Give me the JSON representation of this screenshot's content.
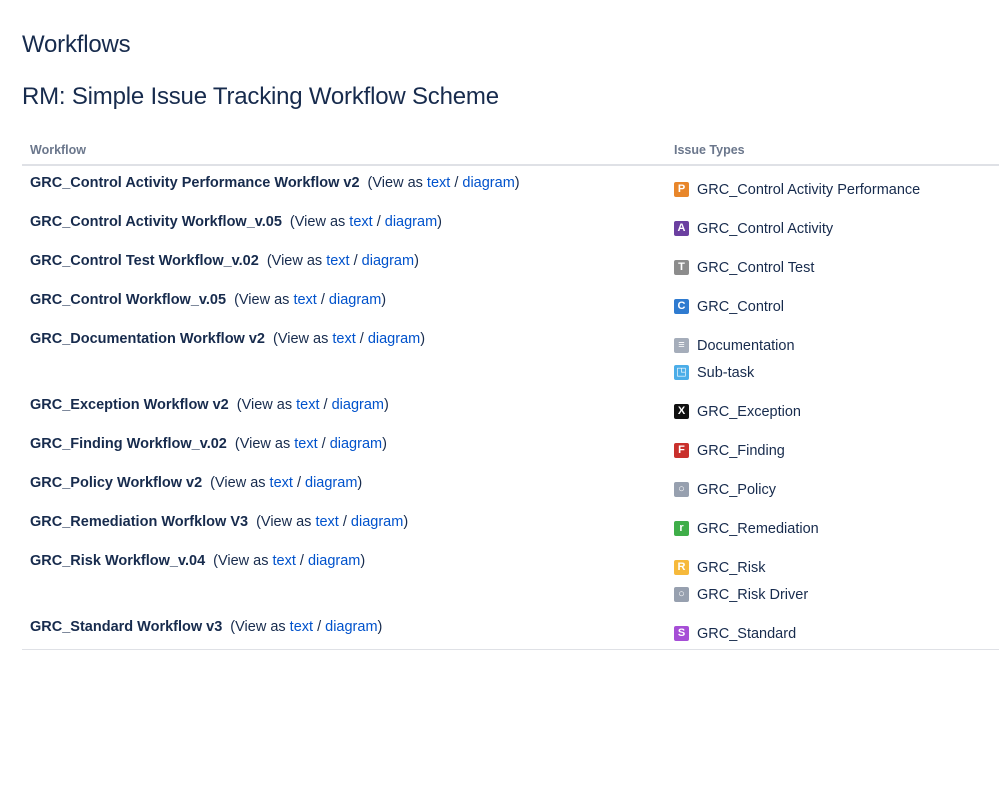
{
  "page": {
    "title": "Workflows",
    "scheme_title": "RM: Simple Issue Tracking Workflow Scheme"
  },
  "table": {
    "headers": {
      "workflow": "Workflow",
      "issue_types": "Issue Types"
    },
    "view_as_prefix": "(View as",
    "text_link": "text",
    "separator": "/",
    "diagram_link": "diagram",
    "close_paren": ")",
    "rows": [
      {
        "workflow": "GRC_Control Activity Performance Workflow v2",
        "issue_types": [
          {
            "label": "GRC_Control Activity Performance",
            "icon": "letter-p-icon",
            "glyph": "P",
            "color": "#e8862a"
          }
        ]
      },
      {
        "workflow": "GRC_Control Activity Workflow_v.05",
        "issue_types": [
          {
            "label": "GRC_Control Activity",
            "icon": "letter-a-icon",
            "glyph": "A",
            "color": "#6b3fa0"
          }
        ]
      },
      {
        "workflow": "GRC_Control Test Workflow_v.02",
        "issue_types": [
          {
            "label": "GRC_Control Test",
            "icon": "letter-t-icon",
            "glyph": "T",
            "color": "#8c8c8c"
          }
        ]
      },
      {
        "workflow": "GRC_Control Workflow_v.05",
        "issue_types": [
          {
            "label": "GRC_Control",
            "icon": "letter-c-icon",
            "glyph": "C",
            "color": "#2f7bd0"
          }
        ]
      },
      {
        "workflow": "GRC_Documentation Workflow v2",
        "issue_types": [
          {
            "label": "Documentation",
            "icon": "document-icon",
            "glyph": "≡",
            "color": "#a5adba"
          },
          {
            "label": "Sub-task",
            "icon": "subtask-icon",
            "glyph": "◳",
            "color": "#4bade8"
          }
        ]
      },
      {
        "workflow": "GRC_Exception Workflow v2",
        "issue_types": [
          {
            "label": "GRC_Exception",
            "icon": "cross-x-icon",
            "glyph": "X",
            "color": "#111111"
          }
        ]
      },
      {
        "workflow": "GRC_Finding Workflow_v.02",
        "issue_types": [
          {
            "label": "GRC_Finding",
            "icon": "letter-f-icon",
            "glyph": "F",
            "color": "#c9302c"
          }
        ]
      },
      {
        "workflow": "GRC_Policy Workflow v2",
        "issue_types": [
          {
            "label": "GRC_Policy",
            "icon": "circle-dot-icon",
            "glyph": "○",
            "color": "#97a0af"
          }
        ]
      },
      {
        "workflow": "GRC_Remediation Worfklow V3",
        "issue_types": [
          {
            "label": "GRC_Remediation",
            "icon": "letter-r-small-icon",
            "glyph": "r",
            "color": "#3fae49"
          }
        ]
      },
      {
        "workflow": "GRC_Risk Workflow_v.04",
        "issue_types": [
          {
            "label": "GRC_Risk",
            "icon": "letter-r-icon",
            "glyph": "R",
            "color": "#f6b93b"
          },
          {
            "label": "GRC_Risk Driver",
            "icon": "circle-dot-icon",
            "glyph": "○",
            "color": "#97a0af"
          }
        ]
      },
      {
        "workflow": "GRC_Standard Workflow v3",
        "issue_types": [
          {
            "label": "GRC_Standard",
            "icon": "letter-s-icon",
            "glyph": "S",
            "color": "#a64ed6"
          }
        ]
      }
    ]
  }
}
